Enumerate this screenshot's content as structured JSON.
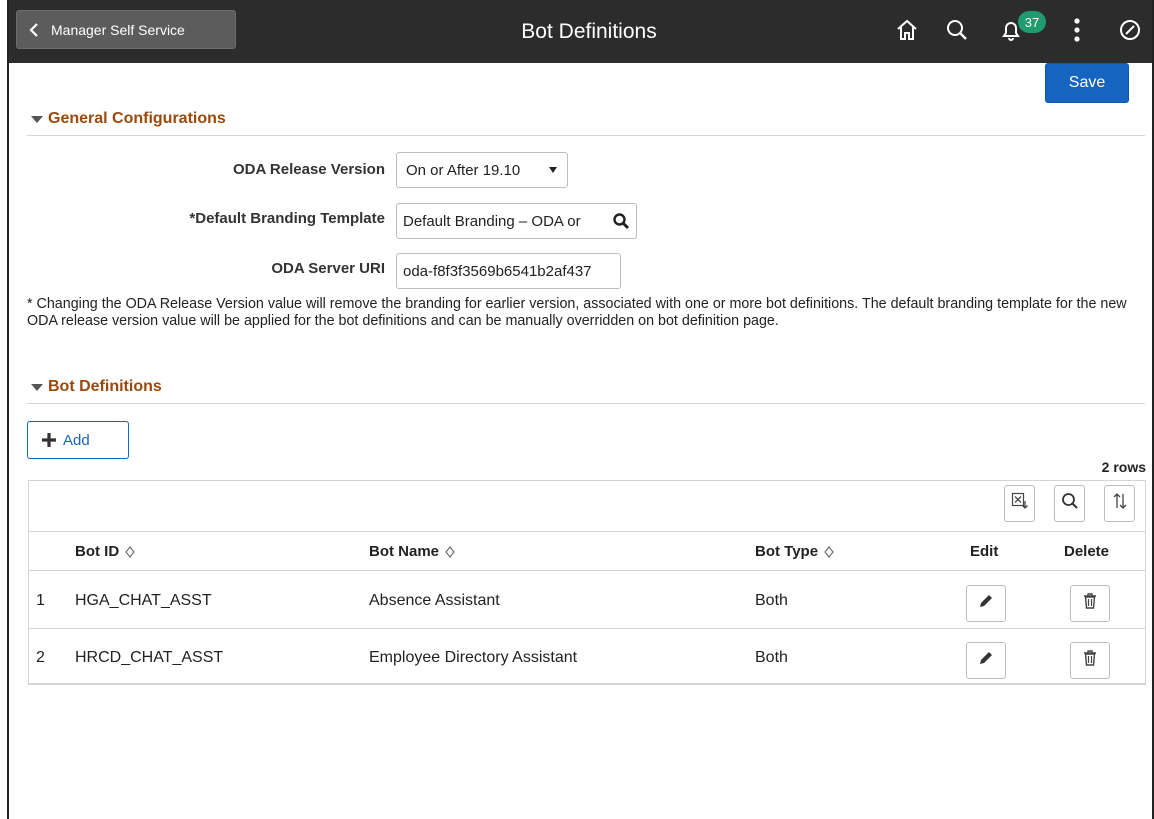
{
  "header": {
    "back_label": "Manager Self Service",
    "title": "Bot Definitions",
    "notification_count": "37",
    "icons": [
      "home-icon",
      "search-icon",
      "bell-icon",
      "more-vertical-icon",
      "navbar-icon"
    ]
  },
  "actions": {
    "save_label": "Save"
  },
  "general": {
    "section_title": "General Configurations",
    "release_label": "ODA Release Version",
    "release_value": "On or After 19.10",
    "branding_label": "*Default Branding Template",
    "branding_value": "Default Branding – ODA or",
    "server_label": "ODA Server URI",
    "server_value": "oda-f8f3f3569b6541b2af437"
  },
  "note": "* Changing the ODA Release Version value will remove the branding for earlier version, associated with one or more bot definitions. The default branding template for the new ODA release version value will be applied for the bot definitions and can be manually overridden on bot definition page.",
  "bots": {
    "section_title": "Bot Definitions",
    "add_label": "Add",
    "row_count": "2 rows",
    "columns": {
      "bot_id": "Bot ID",
      "bot_name": "Bot Name",
      "bot_type": "Bot Type",
      "edit": "Edit",
      "delete": "Delete"
    },
    "rows": [
      {
        "num": "1",
        "bot_id": "HGA_CHAT_ASST",
        "bot_name": "Absence Assistant",
        "bot_type": "Both"
      },
      {
        "num": "2",
        "bot_id": "HRCD_CHAT_ASST",
        "bot_name": "Employee Directory Assistant",
        "bot_type": "Both"
      }
    ]
  },
  "colors": {
    "header_bg": "#2c2c2c",
    "accent": "#1565c0",
    "section_title": "#9b4a0e",
    "badge": "#1f9b6f"
  }
}
